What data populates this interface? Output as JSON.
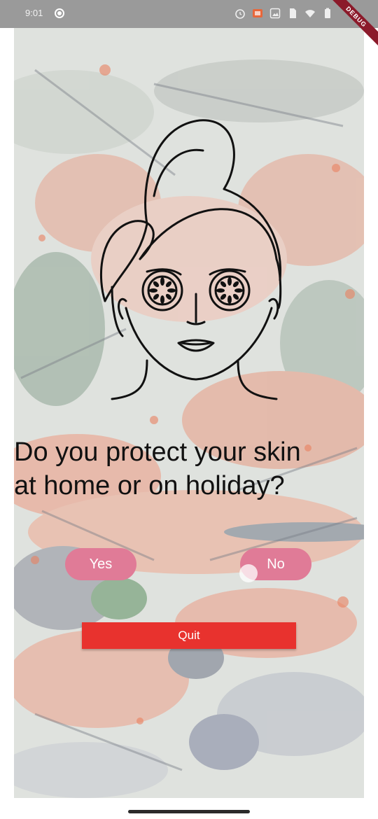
{
  "status_bar": {
    "time": "9:01",
    "icons": [
      "circle-dot-icon",
      "alarm-icon",
      "cast-icon",
      "photo-icon",
      "sim-icon",
      "wifi-icon",
      "battery-icon"
    ]
  },
  "debug_banner": "DEBUG",
  "illustration": "face-mask-woman-icon",
  "question": {
    "line1": "Do you protect your skin",
    "line2": "at home or on holiday?"
  },
  "buttons": {
    "yes": "Yes",
    "no": "No",
    "quit": "Quit"
  },
  "colors": {
    "pill": "#e07b97",
    "quit": "#e8322e",
    "text": "#111111"
  }
}
